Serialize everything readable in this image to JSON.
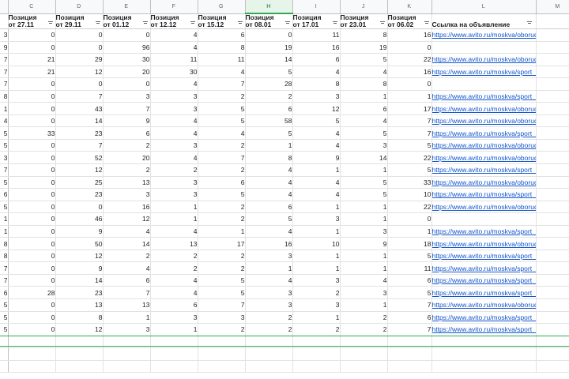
{
  "columns": [
    "C",
    "D",
    "E",
    "F",
    "G",
    "H",
    "I",
    "J",
    "K",
    "L",
    "M"
  ],
  "selected_column": "H",
  "headers": [
    "Позиция от 27.11",
    "Позиция от 29.11",
    "Позиция от 01.12",
    "Позиция от 12.12",
    "Позиция от 15.12",
    "Позиция от 08.01",
    "Позиция от 17.01",
    "Позиция от 23.01",
    "Позиция от 06.02",
    "Ссылка на объявление"
  ],
  "rows": [
    {
      "b": "3",
      "vals": [
        "0",
        "0",
        "0",
        "4",
        "6",
        "0",
        "11",
        "8",
        "16"
      ],
      "link": "https://www.avito.ru/moskva/oborudovanie_"
    },
    {
      "b": "9",
      "vals": [
        "0",
        "0",
        "96",
        "4",
        "8",
        "19",
        "16",
        "19",
        "0"
      ],
      "link": ""
    },
    {
      "b": "7",
      "vals": [
        "21",
        "29",
        "30",
        "11",
        "11",
        "14",
        "6",
        "5",
        "22"
      ],
      "link": "https://www.avito.ru/moskva/oborudovanie_"
    },
    {
      "b": "7",
      "vals": [
        "21",
        "12",
        "20",
        "30",
        "4",
        "5",
        "4",
        "4",
        "16"
      ],
      "link": "https://www.avito.ru/moskva/sport_i_otdyh/"
    },
    {
      "b": "7",
      "vals": [
        "0",
        "0",
        "0",
        "4",
        "7",
        "28",
        "8",
        "8",
        "0"
      ],
      "link": ""
    },
    {
      "b": "8",
      "vals": [
        "0",
        "7",
        "3",
        "3",
        "2",
        "2",
        "3",
        "1",
        "1"
      ],
      "link": "https://www.avito.ru/moskva/sport_i_otdyh/sp"
    },
    {
      "b": "1",
      "vals": [
        "0",
        "43",
        "7",
        "3",
        "5",
        "6",
        "12",
        "6",
        "17"
      ],
      "link": "https://www.avito.ru/moskva/oborudovanie_"
    },
    {
      "b": "4",
      "vals": [
        "0",
        "14",
        "9",
        "4",
        "5",
        "58",
        "5",
        "4",
        "7"
      ],
      "link": "https://www.avito.ru/moskva/oborudovanie_"
    },
    {
      "b": "5",
      "vals": [
        "33",
        "23",
        "6",
        "4",
        "4",
        "5",
        "4",
        "5",
        "7"
      ],
      "link": "https://www.avito.ru/moskva/sport_i_otdyh/s"
    },
    {
      "b": "5",
      "vals": [
        "0",
        "7",
        "2",
        "3",
        "2",
        "1",
        "4",
        "3",
        "5"
      ],
      "link": "https://www.avito.ru/moskva/oborudovanie_"
    },
    {
      "b": "3",
      "vals": [
        "0",
        "52",
        "20",
        "4",
        "7",
        "8",
        "9",
        "14",
        "22"
      ],
      "link": "https://www.avito.ru/moskva/oborudovanie_"
    },
    {
      "b": "7",
      "vals": [
        "0",
        "12",
        "2",
        "2",
        "2",
        "4",
        "1",
        "1",
        "5"
      ],
      "link": "https://www.avito.ru/moskva/sport_i_otdyh/s"
    },
    {
      "b": "5",
      "vals": [
        "0",
        "25",
        "13",
        "3",
        "6",
        "4",
        "4",
        "5",
        "33"
      ],
      "link": "https://www.avito.ru/moskva/oborudovanie_"
    },
    {
      "b": "6",
      "vals": [
        "0",
        "23",
        "3",
        "3",
        "5",
        "4",
        "4",
        "5",
        "10"
      ],
      "link": "https://www.avito.ru/moskva/sport_i_otdyh/s"
    },
    {
      "b": "5",
      "vals": [
        "0",
        "0",
        "16",
        "1",
        "2",
        "6",
        "1",
        "1",
        "22"
      ],
      "link": "https://www.avito.ru/moskva/oborudovanie_"
    },
    {
      "b": "1",
      "vals": [
        "0",
        "46",
        "12",
        "1",
        "2",
        "5",
        "3",
        "1",
        "0"
      ],
      "link": ""
    },
    {
      "b": "1",
      "vals": [
        "0",
        "9",
        "4",
        "4",
        "1",
        "4",
        "1",
        "3",
        "1"
      ],
      "link": "https://www.avito.ru/moskva/sport_i_otdyh/sp"
    },
    {
      "b": "8",
      "vals": [
        "0",
        "50",
        "14",
        "13",
        "17",
        "16",
        "10",
        "9",
        "18"
      ],
      "link": "https://www.avito.ru/moskva/oborudovanie_"
    },
    {
      "b": "8",
      "vals": [
        "0",
        "12",
        "2",
        "2",
        "2",
        "3",
        "1",
        "1",
        "5"
      ],
      "link": "https://www.avito.ru/moskva/sport_i_otdyh/s"
    },
    {
      "b": "7",
      "vals": [
        "0",
        "9",
        "4",
        "2",
        "2",
        "1",
        "1",
        "1",
        "11"
      ],
      "link": "https://www.avito.ru/moskva/sport_i_otdyh/s"
    },
    {
      "b": "7",
      "vals": [
        "0",
        "14",
        "6",
        "4",
        "5",
        "4",
        "3",
        "4",
        "6"
      ],
      "link": "https://www.avito.ru/moskva/sport_i_otdyh/s"
    },
    {
      "b": "6",
      "vals": [
        "28",
        "23",
        "7",
        "4",
        "5",
        "3",
        "2",
        "3",
        "5"
      ],
      "link": "https://www.avito.ru/moskva/sport_i_otdyh/s"
    },
    {
      "b": "5",
      "vals": [
        "0",
        "13",
        "13",
        "6",
        "7",
        "3",
        "3",
        "1",
        "7"
      ],
      "link": "https://www.avito.ru/moskva/oborudovanie_"
    },
    {
      "b": "5",
      "vals": [
        "0",
        "8",
        "1",
        "3",
        "3",
        "2",
        "1",
        "2",
        "6"
      ],
      "link": "https://www.avito.ru/moskva/sport_i_otdyh/s"
    },
    {
      "b": "5",
      "vals": [
        "0",
        "12",
        "3",
        "1",
        "2",
        "2",
        "2",
        "2",
        "7"
      ],
      "link": "https://www.avito.ru/moskva/sport_i_otdyh/s"
    }
  ],
  "empty_rows": 3,
  "colors": {
    "selected": "#34a853",
    "link": "#1155cc",
    "header_bg": "#f8f9fa"
  }
}
